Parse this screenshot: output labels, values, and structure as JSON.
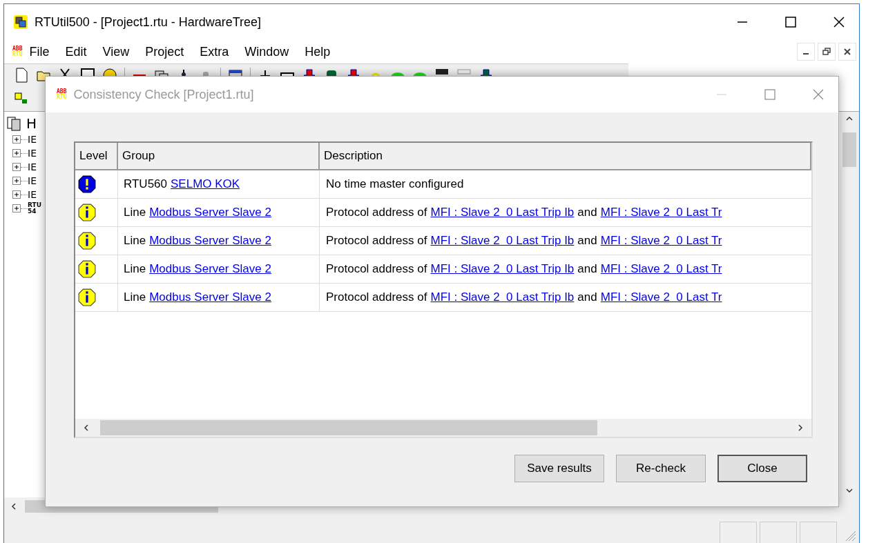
{
  "window": {
    "title": "RTUtil500 - [Project1.rtu - HardwareTree]"
  },
  "menu": {
    "logo": [
      "ABB",
      "RTU"
    ],
    "items": [
      "File",
      "Edit",
      "View",
      "Project",
      "Extra",
      "Window",
      "Help"
    ]
  },
  "tree": {
    "title": "H",
    "items": [
      {
        "lines": [
          "IE"
        ],
        "expanded": false
      },
      {
        "lines": [
          "IE"
        ],
        "expanded": false
      },
      {
        "lines": [
          "IE"
        ],
        "expanded": false
      },
      {
        "lines": [
          "IE"
        ],
        "expanded": false
      },
      {
        "lines": [
          "IE"
        ],
        "expanded": false
      },
      {
        "lines": [
          "RTU",
          "54"
        ],
        "expanded": false
      }
    ]
  },
  "dialog": {
    "logo": [
      "ABB",
      "RTU"
    ],
    "title": "Consistency Check [Project1.rtu]",
    "columns": [
      "Level",
      "Group",
      "Description"
    ],
    "rows": [
      {
        "kind": "error",
        "group": [
          {
            "kind": "text",
            "text": "RTU560"
          },
          {
            "kind": "link",
            "text": "SELMO KOK"
          }
        ],
        "description": [
          {
            "kind": "text",
            "text": "No time master configured"
          }
        ]
      },
      {
        "kind": "info",
        "group": [
          {
            "kind": "text",
            "text": "Line"
          },
          {
            "kind": "link",
            "text": "Modbus Server Slave 2"
          }
        ],
        "description": [
          {
            "kind": "text",
            "text": "Protocol address of"
          },
          {
            "kind": "link",
            "text": "MFI : Slave 2  0 Last Trip Ib"
          },
          {
            "kind": "text",
            "text": "and"
          },
          {
            "kind": "link",
            "text": "MFI : Slave 2  0 Last Tr"
          }
        ]
      },
      {
        "kind": "info",
        "group": [
          {
            "kind": "text",
            "text": "Line"
          },
          {
            "kind": "link",
            "text": "Modbus Server Slave 2"
          }
        ],
        "description": [
          {
            "kind": "text",
            "text": "Protocol address of"
          },
          {
            "kind": "link",
            "text": "MFI : Slave 2  0 Last Trip Ib"
          },
          {
            "kind": "text",
            "text": "and"
          },
          {
            "kind": "link",
            "text": "MFI : Slave 2  0 Last Tr"
          }
        ]
      },
      {
        "kind": "info",
        "group": [
          {
            "kind": "text",
            "text": "Line"
          },
          {
            "kind": "link",
            "text": "Modbus Server Slave 2"
          }
        ],
        "description": [
          {
            "kind": "text",
            "text": "Protocol address of"
          },
          {
            "kind": "link",
            "text": "MFI : Slave 2  0 Last Trip Ib"
          },
          {
            "kind": "text",
            "text": "and"
          },
          {
            "kind": "link",
            "text": "MFI : Slave 2  0 Last Tr"
          }
        ]
      },
      {
        "kind": "info",
        "group": [
          {
            "kind": "text",
            "text": "Line"
          },
          {
            "kind": "link",
            "text": "Modbus Server Slave 2"
          }
        ],
        "description": [
          {
            "kind": "text",
            "text": "Protocol address of"
          },
          {
            "kind": "link",
            "text": "MFI : Slave 2  0 Last Trip Ib"
          },
          {
            "kind": "text",
            "text": "and"
          },
          {
            "kind": "link",
            "text": "MFI : Slave 2  0 Last Tr"
          }
        ]
      }
    ],
    "buttons": [
      {
        "label": "Save results",
        "default": false
      },
      {
        "label": "Re-check",
        "default": false
      },
      {
        "label": "Close",
        "default": true
      }
    ]
  }
}
